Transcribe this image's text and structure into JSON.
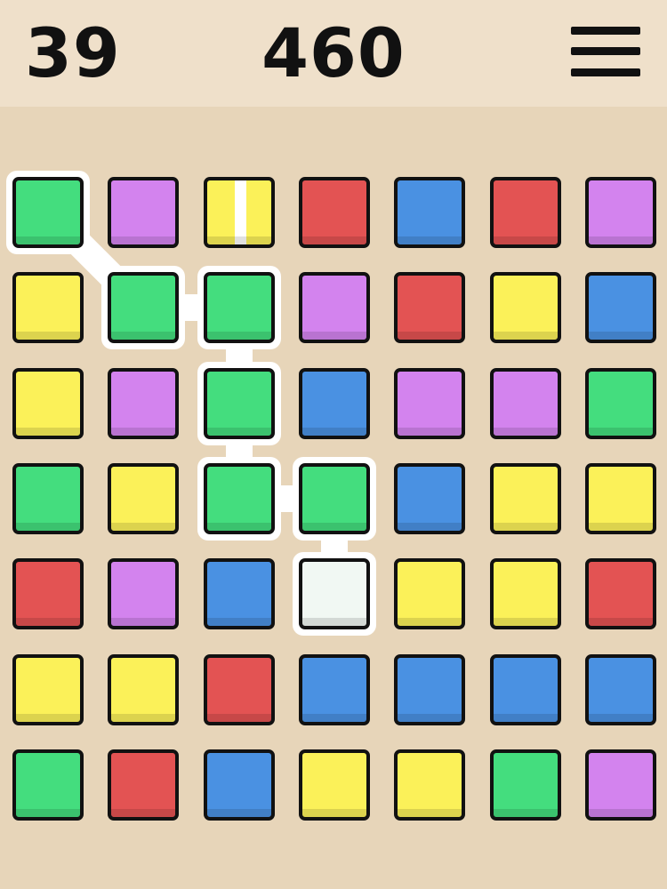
{
  "hud": {
    "moves": "39",
    "score": "460",
    "menu_icon": "hamburger-menu-icon"
  },
  "palette": {
    "G": "#44dd7e",
    "P": "#d383ee",
    "Y": "#fbf159",
    "R": "#e35353",
    "B": "#4a91e2",
    "W": "#f1f8f3",
    "outline": "#111111",
    "path": "#ffffff",
    "board_bg": "#e7d5b9",
    "topbar_bg": "#efe0ca"
  },
  "board": {
    "rows": 7,
    "cols": 7,
    "tiles": [
      [
        "G",
        "P",
        "Y",
        "R",
        "B",
        "R",
        "P"
      ],
      [
        "Y",
        "G",
        "G",
        "P",
        "R",
        "Y",
        "B"
      ],
      [
        "Y",
        "P",
        "G",
        "B",
        "P",
        "P",
        "G"
      ],
      [
        "G",
        "Y",
        "G",
        "G",
        "B",
        "Y",
        "Y"
      ],
      [
        "R",
        "P",
        "B",
        "W",
        "Y",
        "Y",
        "R"
      ],
      [
        "Y",
        "Y",
        "R",
        "B",
        "B",
        "B",
        "B"
      ],
      [
        "G",
        "R",
        "B",
        "Y",
        "Y",
        "G",
        "P"
      ]
    ],
    "special_tiles": [
      {
        "row": 0,
        "col": 2,
        "type": "vertical-stripe"
      }
    ],
    "selected_path": [
      [
        0,
        0
      ],
      [
        1,
        1
      ],
      [
        1,
        2
      ],
      [
        2,
        2
      ],
      [
        3,
        2
      ],
      [
        3,
        3
      ],
      [
        4,
        3
      ]
    ]
  }
}
